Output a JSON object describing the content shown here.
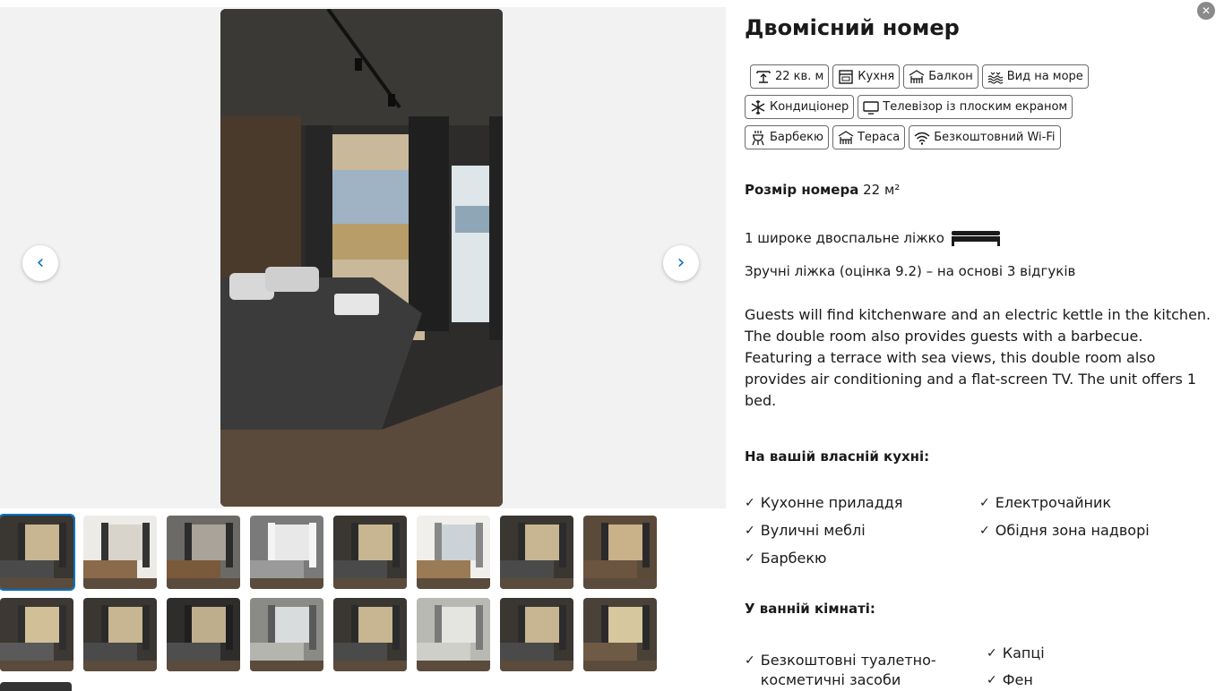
{
  "gallery": {
    "prev_label": "‹",
    "next_label": "›",
    "thumbnail_rows": [
      [
        "room-bed-window",
        "room-tv-desk",
        "room-mirror",
        "room-towels",
        "room-bed-window",
        "room-desk",
        "room-bed-window",
        "room-wall-panel"
      ],
      [
        "room-bed-wide",
        "room-bed-window",
        "room-bed-curtains",
        "room-shower",
        "room-bed-window",
        "room-shower-wall",
        "room-bed-window",
        "room-window"
      ]
    ]
  },
  "room": {
    "title": "Двомісний номер",
    "close_label": "✕",
    "facilities": [
      [
        {
          "icon": "size-icon",
          "label": "22 кв. м"
        },
        {
          "icon": "kitchen-icon",
          "label": "Кухня"
        },
        {
          "icon": "balcony-icon",
          "label": "Балкон"
        },
        {
          "icon": "sea-view-icon",
          "label": "Вид на море"
        }
      ],
      [
        {
          "icon": "snowflake-icon",
          "label": "Кондиціонер"
        },
        {
          "icon": "tv-icon",
          "label": "Телевізор із плоским екраном"
        }
      ],
      [
        {
          "icon": "grill-icon",
          "label": "Барбекю"
        },
        {
          "icon": "terrace-icon",
          "label": "Тераса"
        },
        {
          "icon": "wifi-icon",
          "label": "Безкоштовний Wi-Fi"
        }
      ]
    ],
    "size_label": "Розмір номера",
    "size_value": "22 м²",
    "bed_text": "1 широке двоспальне ліжко",
    "comfort_text": "Зручні ліжка (оцінка 9.2) – на основі 3 відгуків",
    "description": "Guests will find kitchenware and an electric kettle in the kitchen. The double room also provides guests with a barbecue. Featuring a terrace with sea views, this double room also provides air conditioning and a flat-screen TV. The unit offers 1 bed.",
    "kitchen_title": "На вашій власній кухні:",
    "kitchen_items": [
      "Кухонне приладдя",
      "Електрочайник",
      "Вуличні меблі",
      "Обідня зона надворі",
      "Барбекю"
    ],
    "bathroom_title": "У ванній кімнаті:",
    "bathroom_items": [
      "Безкоштовні туалетно-\nкосметичні засоби",
      "Капці",
      "Фен"
    ]
  }
}
